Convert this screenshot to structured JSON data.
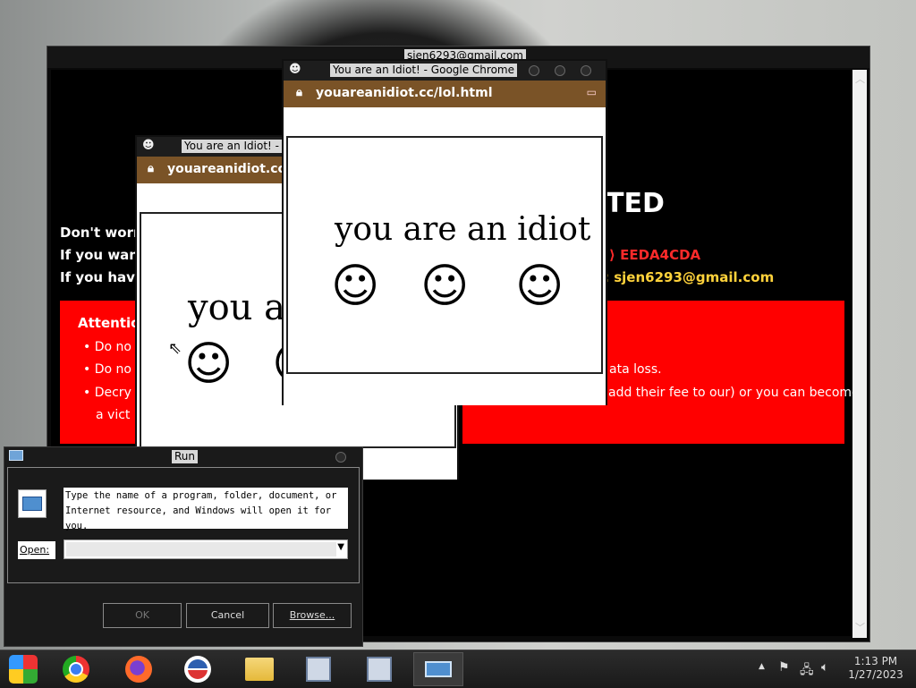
{
  "ransom": {
    "title": "sjen6293@gmail.com",
    "heading": "TED",
    "line1": "Don't worry",
    "line2": "If you want",
    "line3": "If you have",
    "id_code": "EEDA4CDA",
    "email": "sjen6293@gmail.com",
    "attention_label": "Attention",
    "bullet1": "Do no",
    "bullet2": "Do no",
    "bullet3": "Decry",
    "bullet3_cont": "a vict",
    "right1": "ata loss.",
    "right2": "add their fee to our) or you can become"
  },
  "chrome_back": {
    "title": "You are an Idiot! - Go",
    "url": "youareanidiot.cc/lol",
    "text": "you are"
  },
  "chrome_front": {
    "title": "You are an Idiot! - Google Chrome",
    "url": "youareanidiot.cc/lol.html",
    "text": "you are an idiot"
  },
  "run": {
    "title": "Run",
    "description": "Type the name of a program, folder, document, or Internet resource, and Windows will open it for you.",
    "open_label": "Open:",
    "open_value": "",
    "ok": "OK",
    "cancel": "Cancel",
    "browse": "Browse..."
  },
  "taskbar": {
    "time": "1:13 PM",
    "date": "1/27/2023",
    "apps": [
      "start-icon",
      "chrome-icon",
      "firefox-icon",
      "obama-icon",
      "file-explorer-icon",
      "installer-icon",
      "installer-icon",
      "run-icon"
    ]
  }
}
